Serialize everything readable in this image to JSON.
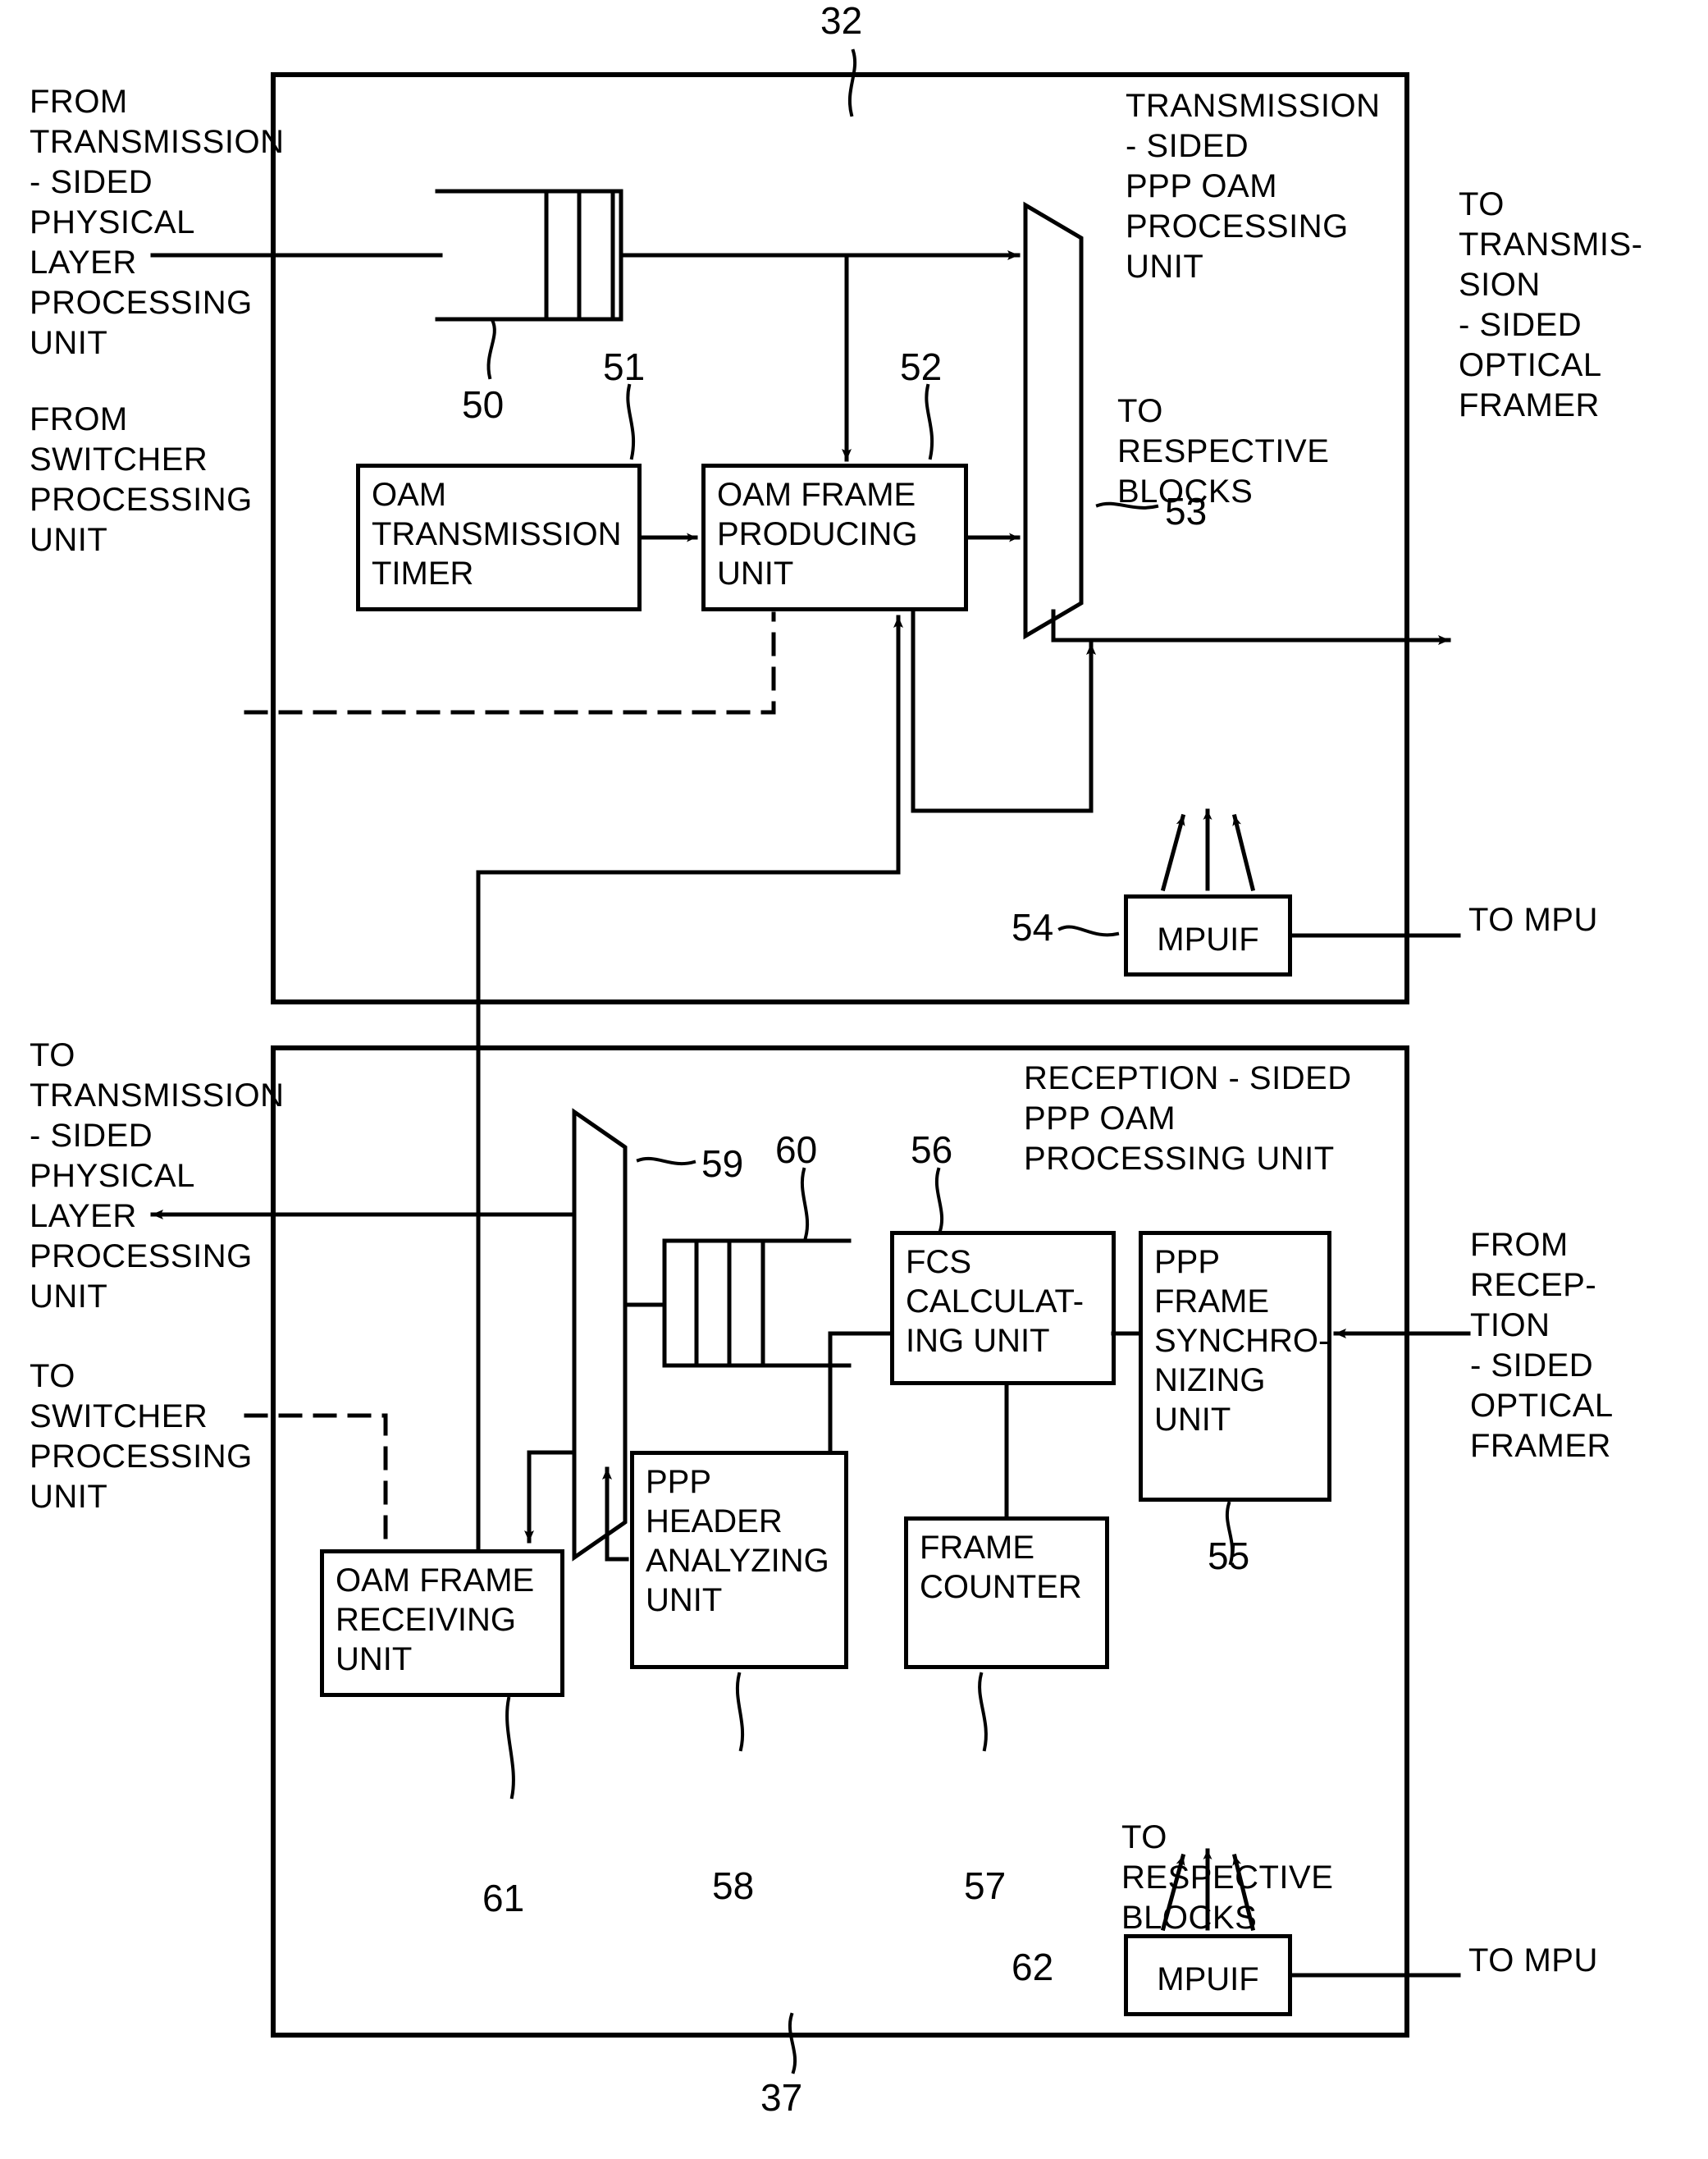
{
  "figure": {
    "top_ref": "32",
    "bottom_ref": "37"
  },
  "transmission_section": {
    "title": "TRANSMISSION\n- SIDED\nPPP OAM\nPROCESSING\nUNIT",
    "inputs": [
      {
        "name": "from-transmission-physical-layer",
        "text": "FROM\nTRANSMISSION\n- SIDED\nPHYSICAL\nLAYER\nPROCESSING\nUNIT"
      },
      {
        "name": "from-switcher",
        "text": "FROM\nSWITCHER\nPROCESSING\nUNIT"
      }
    ],
    "outputs": [
      {
        "name": "to-transmission-optical-framer",
        "text": "TO\nTRANSMIS-\nSION\n- SIDED\nOPTICAL\nFRAMER"
      },
      {
        "name": "to-mpu",
        "text": "TO MPU"
      }
    ],
    "blocks": [
      {
        "ref": "50",
        "name": "transmission-buffer",
        "label": ""
      },
      {
        "ref": "51",
        "name": "oam-transmission-timer",
        "label": "OAM\nTRANSMISSION\nTIMER"
      },
      {
        "ref": "52",
        "name": "oam-frame-producing-unit",
        "label": "OAM FRAME\nPRODUCING\nUNIT"
      },
      {
        "ref": "53",
        "name": "transmission-multiplexer",
        "label": ""
      },
      {
        "ref": "54",
        "name": "mpuif-transmission",
        "label": "MPUIF"
      }
    ],
    "annotations": [
      {
        "name": "to-respective-blocks-tx",
        "text": "TO\nRESPECTIVE\nBLOCKS"
      }
    ]
  },
  "reception_section": {
    "title": "RECEPTION - SIDED\nPPP OAM\nPROCESSING UNIT",
    "inputs": [
      {
        "name": "from-reception-optical-framer",
        "text": "FROM\nRECEP-\nTION\n- SIDED\nOPTICAL\nFRAMER"
      }
    ],
    "outputs": [
      {
        "name": "to-transmission-physical-layer",
        "text": "TO\nTRANSMISSION\n- SIDED\nPHYSICAL\nLAYER\nPROCESSING\nUNIT"
      },
      {
        "name": "to-switcher",
        "text": "TO\nSWITCHER\nPROCESSING\nUNIT"
      },
      {
        "name": "to-mpu",
        "text": "TO MPU"
      }
    ],
    "blocks": [
      {
        "ref": "55",
        "name": "ppp-frame-synchronizing-unit",
        "label": "PPP\nFRAME\nSYNCHRO-\nNIZING\nUNIT"
      },
      {
        "ref": "56",
        "name": "fcs-calculating-unit",
        "label": "FCS\nCALCULAT-\nING UNIT"
      },
      {
        "ref": "57",
        "name": "frame-counter",
        "label": "FRAME\nCOUNTER"
      },
      {
        "ref": "58",
        "name": "ppp-header-analyzing-unit",
        "label": "PPP\nHEADER\nANALYZING\nUNIT"
      },
      {
        "ref": "59",
        "name": "reception-multiplexer",
        "label": ""
      },
      {
        "ref": "60",
        "name": "reception-buffer",
        "label": ""
      },
      {
        "ref": "61",
        "name": "oam-frame-receiving-unit",
        "label": "OAM FRAME\nRECEIVING\nUNIT"
      },
      {
        "ref": "62",
        "name": "mpuif-reception",
        "label": "MPUIF"
      }
    ],
    "annotations": [
      {
        "name": "to-respective-blocks-rx",
        "text": "TO\nRESPECTIVE\nBLOCKS"
      }
    ]
  }
}
